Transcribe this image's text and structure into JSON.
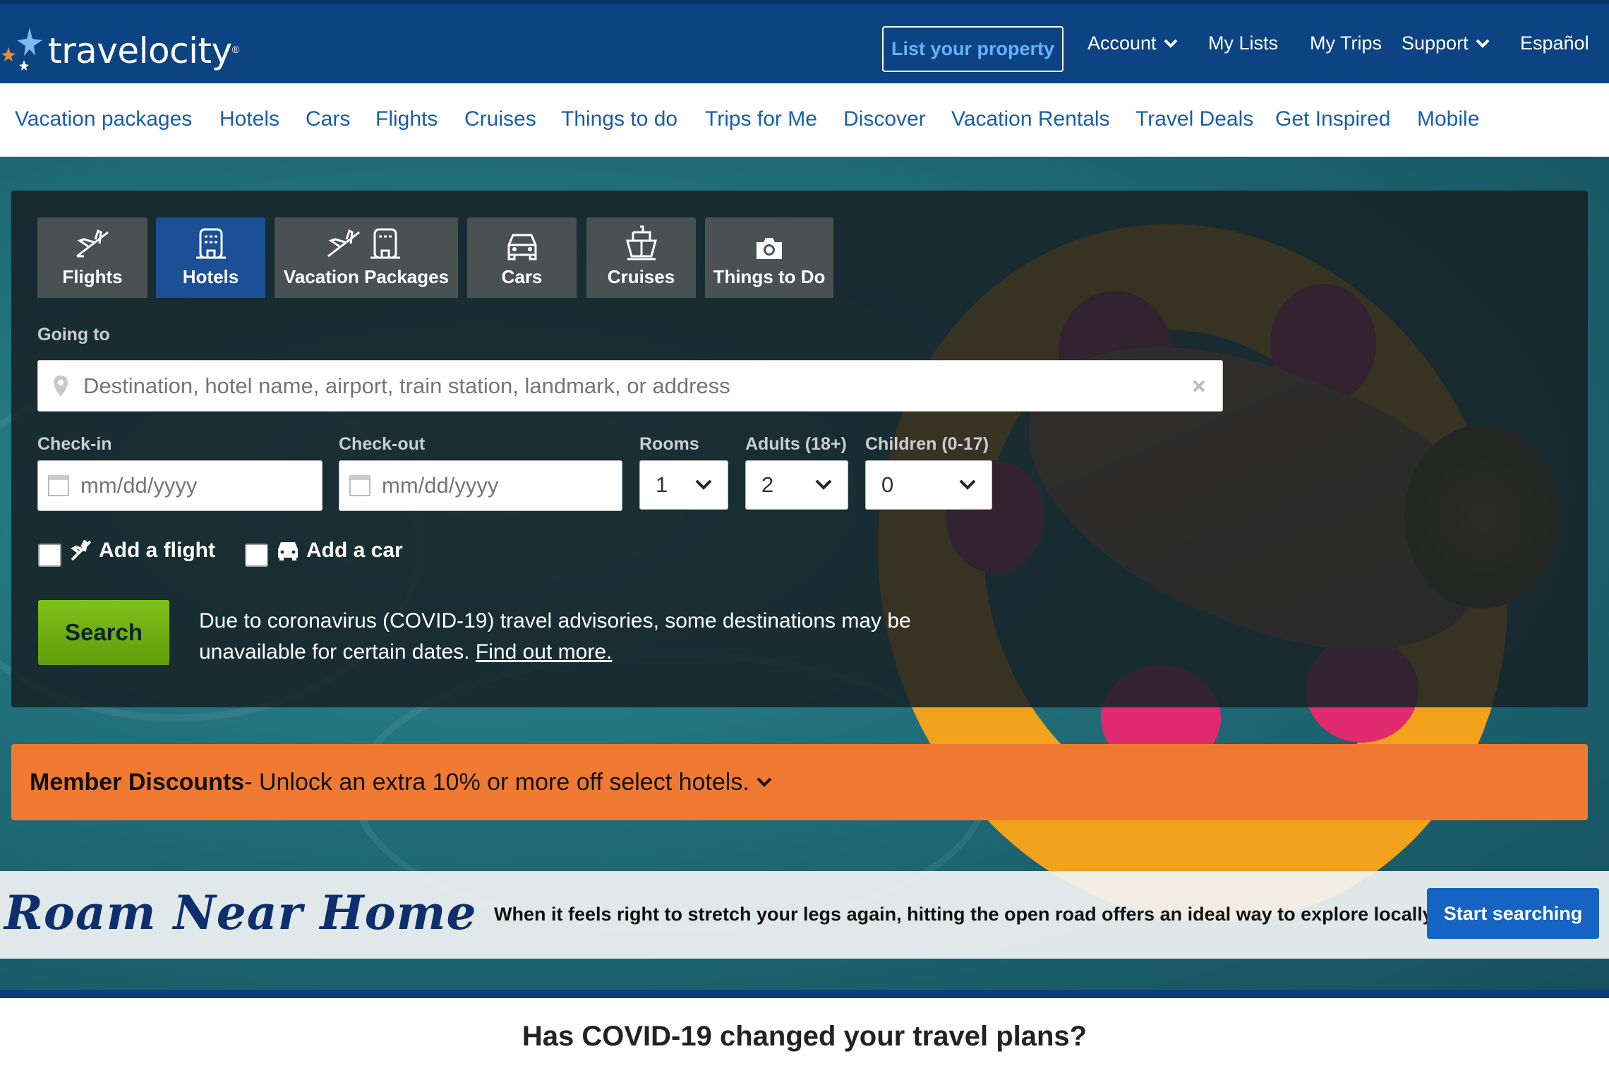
{
  "brand": {
    "name": "travelocity",
    "reg": "®"
  },
  "header": {
    "list_property": "List your property",
    "account": "Account",
    "my_lists": "My Lists",
    "my_trips": "My Trips",
    "support": "Support",
    "language": "Español"
  },
  "nav": [
    "Vacation packages",
    "Hotels",
    "Cars",
    "Flights",
    "Cruises",
    "Things to do",
    "Trips for Me",
    "Discover",
    "Vacation Rentals",
    "Travel Deals",
    "Get Inspired",
    "Mobile"
  ],
  "tabs": [
    {
      "label": "Flights",
      "icon": "plane-icon"
    },
    {
      "label": "Hotels",
      "icon": "hotel-icon",
      "active": true
    },
    {
      "label": "Vacation Packages",
      "icon": "package-icon"
    },
    {
      "label": "Cars",
      "icon": "car-icon"
    },
    {
      "label": "Cruises",
      "icon": "ship-icon"
    },
    {
      "label": "Things to Do",
      "icon": "camera-icon"
    }
  ],
  "search": {
    "going_to_label": "Going to",
    "destination_placeholder": "Destination, hotel name, airport, train station, landmark, or address",
    "checkin_label": "Check-in",
    "checkout_label": "Check-out",
    "date_placeholder": "mm/dd/yyyy",
    "rooms_label": "Rooms",
    "rooms_value": "1",
    "adults_label": "Adults (18+)",
    "adults_value": "2",
    "children_label": "Children (0-17)",
    "children_value": "0",
    "add_flight": "Add a flight",
    "add_car": "Add a car",
    "search_button": "Search",
    "covid_note": "Due to coronavirus (COVID-19) travel advisories, some destinations may be unavailable for certain dates.",
    "covid_link": "Find out more."
  },
  "discount": {
    "bold": "Member Discounts",
    "text": " - Unlock an extra 10% or more off select hotels."
  },
  "roam": {
    "title": "Roam Near Home",
    "text": "When it feels right to stretch your legs again, hitting the open road offers an ideal way to explore locally.",
    "button": "Start searching"
  },
  "covid_heading": "Has COVID-19 changed your travel plans?",
  "colors": {
    "header_bg": "#0c4383",
    "nav_link": "#1a5eab",
    "search_green": "#6fae12",
    "discount_orange": "#f07a32",
    "cta_blue": "#1564c3"
  }
}
